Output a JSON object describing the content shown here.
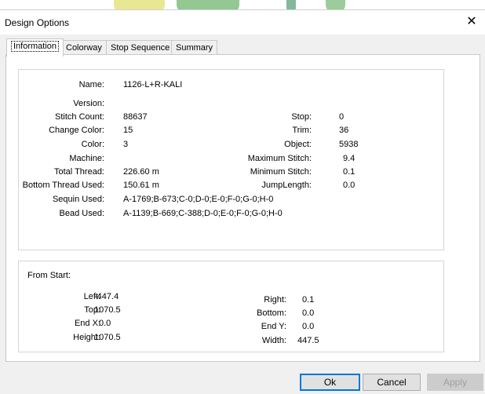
{
  "window": {
    "title": "Design Options",
    "close_label": "✕"
  },
  "tabs": [
    {
      "label": "Information",
      "active": true
    },
    {
      "label": "Colorway",
      "active": false
    },
    {
      "label": "Stop Sequence",
      "active": false
    },
    {
      "label": "Summary",
      "active": false
    }
  ],
  "info": {
    "name_label": "Name:",
    "name": "1126-L+R-KALI",
    "version_label": "Version:",
    "version": "",
    "stitch_count_label": "Stitch Count:",
    "stitch_count": "88637",
    "change_color_label": "Change Color:",
    "change_color": "15",
    "color_label": "Color:",
    "color": "3",
    "machine_label": "Machine:",
    "machine": "",
    "total_thread_label": "Total Thread:",
    "total_thread": "226.60 m",
    "bottom_thread_label": "Bottom Thread Used:",
    "bottom_thread": "150.61 m",
    "sequin_label": "Sequin Used:",
    "sequin": "A-1769;B-673;C-0;D-0;E-0;F-0;G-0;H-0",
    "bead_label": "Bead Used:",
    "bead": "A-1139;B-669;C-388;D-0;E-0;F-0;G-0;H-0",
    "stop_label": "Stop:",
    "stop": "0",
    "trim_label": "Trim:",
    "trim": "36",
    "object_label": "Object:",
    "object": "5938",
    "max_stitch_label": "Maximum Stitch:",
    "max_stitch": "9.4",
    "min_stitch_label": "Minimum Stitch:",
    "min_stitch": "0.1",
    "jump_length_label": "JumpLength:",
    "jump_length": "0.0"
  },
  "from_start": {
    "heading": "From Start:",
    "left_label": "Left:",
    "left": "-447.4",
    "top_label": "Top:",
    "top": "1070.5",
    "endx_label": "End X:",
    "endx": "0.0",
    "height_label": "Height:",
    "height": "1070.5",
    "right_label": "Right:",
    "right": "0.1",
    "bottom_label": "Bottom:",
    "bottom": "0.0",
    "endy_label": "End Y:",
    "endy": "0.0",
    "width_label": "Width:",
    "width": "447.5"
  },
  "buttons": {
    "ok": "Ok",
    "cancel": "Cancel",
    "apply": "Apply"
  },
  "colors": {
    "accent": "#0078d7",
    "panel_border": "#c8c8c8"
  }
}
